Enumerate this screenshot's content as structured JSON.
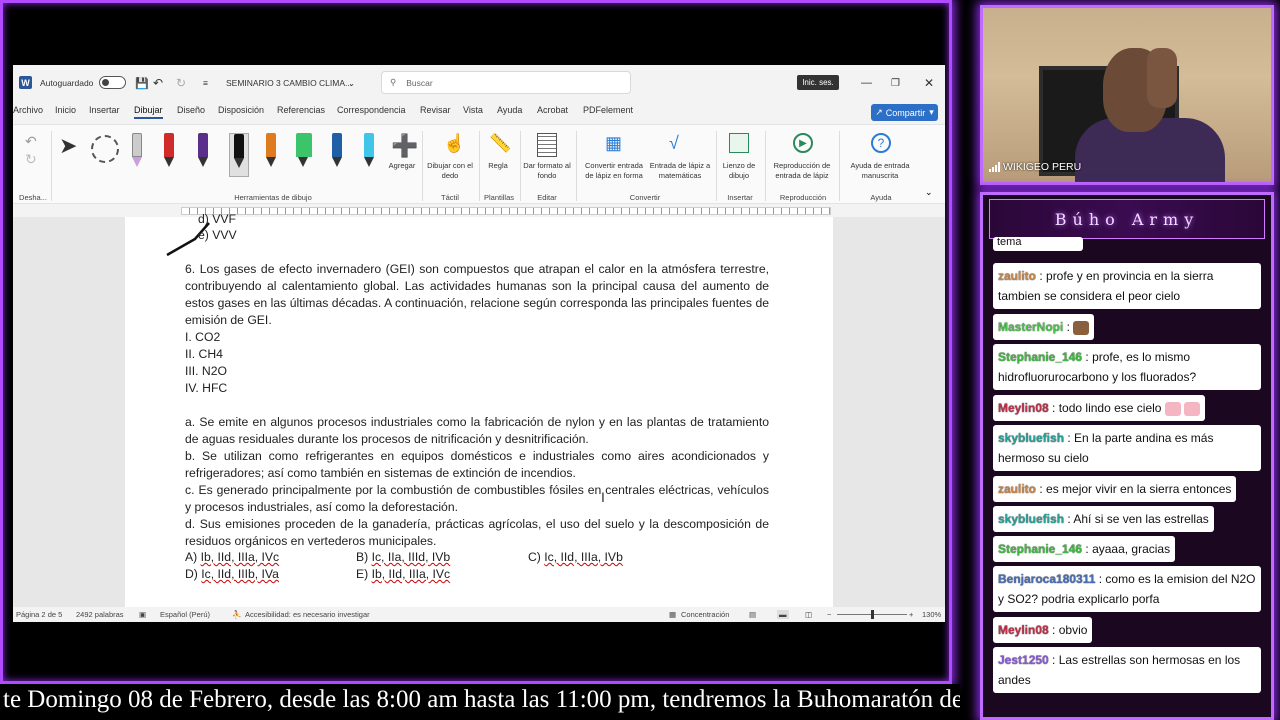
{
  "word": {
    "autosave_label": "Autoguardado",
    "doc_title": "SEMINARIO 3 CAMBIO CLIMA...",
    "search_placeholder": "Buscar",
    "signin_label": "Inic. ses.",
    "share_label": "Compartir",
    "menu": [
      "Archivo",
      "Inicio",
      "Insertar",
      "Dibujar",
      "Diseño",
      "Disposición",
      "Referencias",
      "Correspondencia",
      "Revisar",
      "Vista",
      "Ayuda",
      "Acrobat",
      "PDFelement"
    ],
    "active_menu": "Dibujar",
    "ribbon": {
      "add_label": "Agregar",
      "draw_with_finger": "Dibujar con el dedo",
      "ruler": "Regla",
      "format_bg": "Dar formato al fondo",
      "ink_to_shape": "Convertir entrada de lápiz en forma",
      "ink_to_math": "Entrada de lápiz a matemáticas",
      "canvas": "Lienzo de dibujo",
      "replay": "Reproducción de entrada de lápiz",
      "ink_help": "Ayuda de entrada manuscrita",
      "groups": {
        "undo": "Desha...",
        "tools": "Herramientas de dibujo",
        "touch": "Táctil",
        "templates": "Plantillas",
        "edit": "Editar",
        "convert": "Convertir",
        "insert": "Insertar",
        "replay": "Reproducción",
        "help": "Ayuda"
      }
    },
    "document": {
      "prev_lines": [
        "d) VVF",
        "e) VVV"
      ],
      "q6": "6. Los gases de efecto invernadero (GEI) son compuestos que atrapan el calor en la atmósfera terrestre, contribuyendo al calentamiento global. Las actividades humanas son la principal causa del aumento de estos gases en las últimas décadas. A continuación, relacione según corresponda las principales fuentes de emisión de GEI.",
      "gases": [
        "I. CO2",
        "II. CH4",
        "III. N2O",
        "IV. HFC"
      ],
      "a": "a. Se emite en algunos procesos industriales como la fabricación de nylon y en las plantas de tratamiento de aguas residuales durante los procesos de nitrificación y desnitrificación.",
      "b": "b. Se utilizan como refrigerantes en equipos domésticos e industriales como aires acondicionados y refrigeradores; así como también en sistemas de extinción de incendios.",
      "c": "c. Es generado principalmente por la combustión de combustibles fósiles en centrales eléctricas, vehículos y procesos industriales, así como la deforestación.",
      "d": "d. Sus emisiones proceden de la ganadería, prácticas agrícolas, el uso del suelo y la descomposición de residuos orgánicos en vertederos municipales.",
      "options": [
        {
          "letter": "A)",
          "answer": "Ib, IId, IIIa, IVc"
        },
        {
          "letter": "B)",
          "answer": "Ic, IIa, IIId, IVb"
        },
        {
          "letter": "C)",
          "answer": "Ic, IId, IIIa, IVb"
        },
        {
          "letter": "D)",
          "answer": "Ic, IId, IIIb, IVa"
        },
        {
          "letter": "E)",
          "answer": "Ib, IId, IIIa, IVc"
        }
      ]
    },
    "status": {
      "page": "Página 2 de 5",
      "words": "2492 palabras",
      "language": "Español (Perú)",
      "accessibility": "Accesibilidad: es necesario investigar",
      "focus": "Concentración",
      "zoom": "130%"
    }
  },
  "webcam": {
    "label": "WIKIGEO PERU"
  },
  "chat": {
    "title": "Búho Army",
    "partial_top": "tema",
    "messages": [
      {
        "user": "zaulito",
        "color": "#c8864a",
        "text": "profe y en provincia en la sierra tambien se considera el peor cielo"
      },
      {
        "user": "MasterNopi",
        "color": "#4cc24c",
        "text": ""
      },
      {
        "user": "Stephanie_146",
        "color": "#3fb93f",
        "text": "profe, es lo mismo hidrofluorurocarbono y los fluorados?"
      },
      {
        "user": "Meylin08",
        "color": "#c0304a",
        "text": "todo lindo ese cielo"
      },
      {
        "user": "skybluefish",
        "color": "#2aa198",
        "text": "En la parte andina es más hermoso su cielo"
      },
      {
        "user": "zaulito",
        "color": "#c8864a",
        "text": "es mejor vivir en la sierra entonces"
      },
      {
        "user": "skybluefish",
        "color": "#2aa198",
        "text": "Ahí si se ven las estrellas"
      },
      {
        "user": "Stephanie_146",
        "color": "#3fb93f",
        "text": "ayaaa, gracias"
      },
      {
        "user": "Benjaroca180311",
        "color": "#4a6fb5",
        "text": "como es la emision del N2O y SO2? podria explicarlo porfa"
      },
      {
        "user": "Meylin08",
        "color": "#c0304a",
        "text": "obvio"
      },
      {
        "user": "Jest1250",
        "color": "#8a5bd6",
        "text": "Las estrellas son hermosas en los andes"
      }
    ]
  },
  "ticker": {
    "text": "te Domingo 08 de Febrero, desde las 8:00 am hasta las 11:00 pm, tendremos la Buhomaratón de"
  },
  "colors": {
    "accent": "#b04bff",
    "word_blue": "#2b579a"
  }
}
